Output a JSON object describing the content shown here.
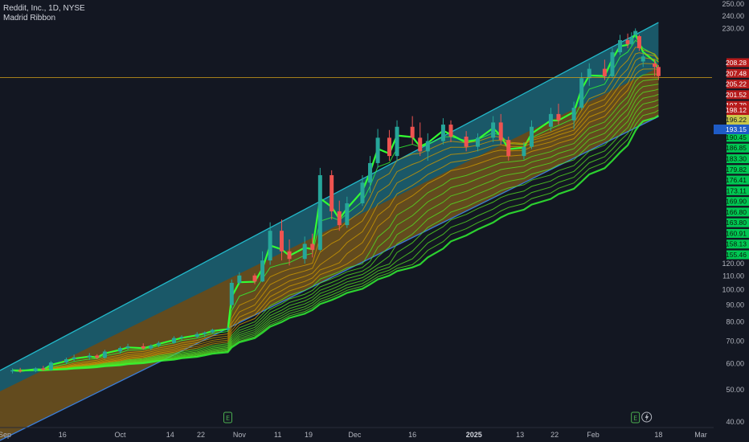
{
  "legend": {
    "symbol_line": "Reddit, Inc., 1D, NYSE",
    "indicator": "Madrid Ribbon"
  },
  "colors": {
    "background": "#131722",
    "up": "#26a69a",
    "down": "#ef5350",
    "channel_fill": "#1e6f80",
    "inner_fill": "#6b4a16",
    "channel_line": "#22b8c9",
    "lower_line": "#3b7dd8",
    "ribbon_bright": "#33ff33",
    "ribbon_dim": "#b8860b",
    "ribbon_mid": "#cc9900",
    "price_line": "#d4a017",
    "tag_red": "#b71c1c",
    "tag_green": "#00c853",
    "tag_blue": "#1e5bc6"
  },
  "chart_data": {
    "type": "candlestick",
    "symbol": "Reddit, Inc.",
    "interval": "1D",
    "exchange": "NYSE",
    "indicator": "Madrid Ribbon",
    "y_scale": "log",
    "ylim": [
      40,
      250
    ],
    "y_ticks": [
      250,
      240,
      230,
      120,
      110,
      100,
      90,
      80,
      70,
      60,
      50,
      40
    ],
    "x_ticks": [
      {
        "label": "Sep",
        "date": "2024-09-01"
      },
      {
        "label": "16",
        "date": "2024-09-16"
      },
      {
        "label": "Oct",
        "date": "2024-10-01"
      },
      {
        "label": "14",
        "date": "2024-10-14"
      },
      {
        "label": "22",
        "date": "2024-10-22"
      },
      {
        "label": "Nov",
        "date": "2024-11-01"
      },
      {
        "label": "11",
        "date": "2024-11-11"
      },
      {
        "label": "19",
        "date": "2024-11-19"
      },
      {
        "label": "Dec",
        "date": "2024-12-01"
      },
      {
        "label": "16",
        "date": "2024-12-16"
      },
      {
        "label": "2025",
        "date": "2025-01-01"
      },
      {
        "label": "13",
        "date": "2025-01-13"
      },
      {
        "label": "22",
        "date": "2025-01-22"
      },
      {
        "label": "Feb",
        "date": "2025-02-01"
      },
      {
        "label": "18",
        "date": "2025-02-18"
      },
      {
        "label": "Mar",
        "date": "2025-03-01"
      }
    ],
    "ribbon_levels": [
      "208.28",
      "207.48",
      "205.22",
      "201.52",
      "197.79",
      "194.18",
      "194.10",
      "190.45",
      "186.85",
      "183.30",
      "179.82",
      "176.41",
      "173.11",
      "169.90",
      "166.80",
      "163.80",
      "160.91",
      "158.13",
      "155.46"
    ],
    "price_tags": [
      {
        "label": "198.12",
        "color": "red"
      },
      {
        "label": "196.22",
        "color": "yellow"
      },
      {
        "label": "193.15",
        "color": "blue"
      }
    ],
    "last_price": 198.12,
    "candles": [
      {
        "d": "2024-09-03",
        "o": 56.8,
        "h": 58.0,
        "l": 56.0,
        "c": 57.2
      },
      {
        "d": "2024-09-05",
        "o": 57.2,
        "h": 58.2,
        "l": 56.3,
        "c": 56.8
      },
      {
        "d": "2024-09-09",
        "o": 56.9,
        "h": 58.5,
        "l": 56.5,
        "c": 58.0
      },
      {
        "d": "2024-09-11",
        "o": 58.0,
        "h": 59.0,
        "l": 57.0,
        "c": 57.4
      },
      {
        "d": "2024-09-13",
        "o": 57.4,
        "h": 61.0,
        "l": 57.0,
        "c": 60.4
      },
      {
        "d": "2024-09-17",
        "o": 60.4,
        "h": 62.5,
        "l": 59.8,
        "c": 61.8
      },
      {
        "d": "2024-09-19",
        "o": 61.8,
        "h": 63.8,
        "l": 61.0,
        "c": 62.6
      },
      {
        "d": "2024-09-23",
        "o": 62.6,
        "h": 64.5,
        "l": 61.5,
        "c": 63.4
      },
      {
        "d": "2024-09-25",
        "o": 63.4,
        "h": 64.0,
        "l": 61.8,
        "c": 62.4
      },
      {
        "d": "2024-09-27",
        "o": 62.4,
        "h": 66.0,
        "l": 62.0,
        "c": 65.2
      },
      {
        "d": "2024-10-01",
        "o": 65.2,
        "h": 67.5,
        "l": 64.2,
        "c": 66.8
      },
      {
        "d": "2024-10-03",
        "o": 66.8,
        "h": 68.8,
        "l": 66.0,
        "c": 67.6
      },
      {
        "d": "2024-10-07",
        "o": 67.6,
        "h": 69.0,
        "l": 66.0,
        "c": 66.6
      },
      {
        "d": "2024-10-09",
        "o": 66.6,
        "h": 68.5,
        "l": 65.8,
        "c": 68.0
      },
      {
        "d": "2024-10-11",
        "o": 68.0,
        "h": 70.0,
        "l": 67.2,
        "c": 69.2
      },
      {
        "d": "2024-10-15",
        "o": 69.2,
        "h": 72.5,
        "l": 68.8,
        "c": 71.6
      },
      {
        "d": "2024-10-17",
        "o": 71.6,
        "h": 73.0,
        "l": 70.5,
        "c": 72.2
      },
      {
        "d": "2024-10-21",
        "o": 72.2,
        "h": 74.6,
        "l": 71.5,
        "c": 73.6
      },
      {
        "d": "2024-10-23",
        "o": 73.6,
        "h": 75.0,
        "l": 72.0,
        "c": 74.4
      },
      {
        "d": "2024-10-25",
        "o": 74.4,
        "h": 76.4,
        "l": 73.8,
        "c": 75.8
      },
      {
        "d": "2024-10-29",
        "o": 75.8,
        "h": 77.5,
        "l": 75.0,
        "c": 76.6
      },
      {
        "d": "2024-10-30",
        "o": 90.0,
        "h": 107.5,
        "l": 88.0,
        "c": 105.0
      },
      {
        "d": "2024-11-01",
        "o": 105.0,
        "h": 113.0,
        "l": 103.5,
        "c": 110.5
      },
      {
        "d": "2024-11-05",
        "o": 110.5,
        "h": 112.0,
        "l": 104.0,
        "c": 106.0
      },
      {
        "d": "2024-11-07",
        "o": 106.0,
        "h": 124.0,
        "l": 105.5,
        "c": 121.0
      },
      {
        "d": "2024-11-09",
        "o": 121.0,
        "h": 134.0,
        "l": 119.0,
        "c": 131.0
      },
      {
        "d": "2024-11-12",
        "o": 131.0,
        "h": 135.0,
        "l": 121.0,
        "c": 124.0
      },
      {
        "d": "2024-11-14",
        "o": 124.0,
        "h": 128.0,
        "l": 118.5,
        "c": 121.5
      },
      {
        "d": "2024-11-18",
        "o": 121.5,
        "h": 129.0,
        "l": 120.0,
        "c": 126.5
      },
      {
        "d": "2024-11-20",
        "o": 126.5,
        "h": 130.0,
        "l": 122.0,
        "c": 124.5
      },
      {
        "d": "2024-11-22",
        "o": 124.5,
        "h": 155.0,
        "l": 124.0,
        "c": 152.0
      },
      {
        "d": "2024-11-25",
        "o": 152.0,
        "h": 154.0,
        "l": 135.0,
        "c": 138.0
      },
      {
        "d": "2024-11-27",
        "o": 138.0,
        "h": 142.0,
        "l": 131.0,
        "c": 133.0
      },
      {
        "d": "2024-11-29",
        "o": 133.0,
        "h": 143.5,
        "l": 132.0,
        "c": 141.0
      },
      {
        "d": "2024-12-03",
        "o": 141.0,
        "h": 152.0,
        "l": 140.0,
        "c": 149.0
      },
      {
        "d": "2024-12-05",
        "o": 149.0,
        "h": 160.0,
        "l": 145.0,
        "c": 157.0
      },
      {
        "d": "2024-12-07",
        "o": 157.0,
        "h": 172.0,
        "l": 155.0,
        "c": 168.0
      },
      {
        "d": "2024-12-10",
        "o": 168.0,
        "h": 171.5,
        "l": 158.0,
        "c": 160.0
      },
      {
        "d": "2024-12-12",
        "o": 160.0,
        "h": 176.0,
        "l": 158.0,
        "c": 173.0
      },
      {
        "d": "2024-12-16",
        "o": 173.0,
        "h": 178.0,
        "l": 165.0,
        "c": 168.0
      },
      {
        "d": "2024-12-18",
        "o": 168.0,
        "h": 175.0,
        "l": 160.0,
        "c": 162.0
      },
      {
        "d": "2024-12-20",
        "o": 162.0,
        "h": 170.0,
        "l": 158.0,
        "c": 166.5
      },
      {
        "d": "2024-12-24",
        "o": 166.5,
        "h": 177.0,
        "l": 165.0,
        "c": 174.0
      },
      {
        "d": "2024-12-26",
        "o": 174.0,
        "h": 176.0,
        "l": 166.0,
        "c": 168.5
      },
      {
        "d": "2024-12-30",
        "o": 168.5,
        "h": 171.0,
        "l": 162.0,
        "c": 164.0
      },
      {
        "d": "2025-01-02",
        "o": 164.0,
        "h": 170.0,
        "l": 162.0,
        "c": 168.0
      },
      {
        "d": "2025-01-06",
        "o": 168.0,
        "h": 178.0,
        "l": 166.0,
        "c": 175.0
      },
      {
        "d": "2025-01-08",
        "o": 175.0,
        "h": 179.0,
        "l": 165.0,
        "c": 167.0
      },
      {
        "d": "2025-01-10",
        "o": 167.0,
        "h": 168.5,
        "l": 158.0,
        "c": 160.0
      },
      {
        "d": "2025-01-14",
        "o": 160.0,
        "h": 166.0,
        "l": 158.5,
        "c": 164.0
      },
      {
        "d": "2025-01-16",
        "o": 164.0,
        "h": 176.0,
        "l": 163.0,
        "c": 173.0
      },
      {
        "d": "2025-01-21",
        "o": 173.0,
        "h": 182.0,
        "l": 171.0,
        "c": 179.0
      },
      {
        "d": "2025-01-23",
        "o": 179.0,
        "h": 184.0,
        "l": 174.0,
        "c": 176.0
      },
      {
        "d": "2025-01-27",
        "o": 176.0,
        "h": 185.0,
        "l": 172.0,
        "c": 182.0
      },
      {
        "d": "2025-01-29",
        "o": 182.0,
        "h": 200.0,
        "l": 181.0,
        "c": 197.0
      },
      {
        "d": "2025-01-31",
        "o": 197.0,
        "h": 205.0,
        "l": 193.0,
        "c": 202.0
      },
      {
        "d": "2025-02-04",
        "o": 202.0,
        "h": 207.0,
        "l": 196.0,
        "c": 198.0
      },
      {
        "d": "2025-02-06",
        "o": 198.0,
        "h": 215.0,
        "l": 197.0,
        "c": 212.0
      },
      {
        "d": "2025-02-08",
        "o": 212.0,
        "h": 225.0,
        "l": 210.0,
        "c": 221.0
      },
      {
        "d": "2025-02-10",
        "o": 221.0,
        "h": 226.0,
        "l": 215.0,
        "c": 218.0
      },
      {
        "d": "2025-02-11",
        "o": 218.0,
        "h": 227.0,
        "l": 217.0,
        "c": 223.0
      },
      {
        "d": "2025-02-12",
        "o": 225.0,
        "h": 230.0,
        "l": 223.0,
        "c": 228.0
      },
      {
        "d": "2025-02-13",
        "o": 224.0,
        "h": 225.0,
        "l": 213.0,
        "c": 215.0
      },
      {
        "d": "2025-02-14",
        "o": 206.0,
        "h": 212.0,
        "l": 203.0,
        "c": 209.0
      },
      {
        "d": "2025-02-17",
        "o": 205.0,
        "h": 207.0,
        "l": 198.0,
        "c": 203.0
      },
      {
        "d": "2025-02-18",
        "o": 203.0,
        "h": 204.0,
        "l": 196.0,
        "c": 198.1
      }
    ]
  }
}
